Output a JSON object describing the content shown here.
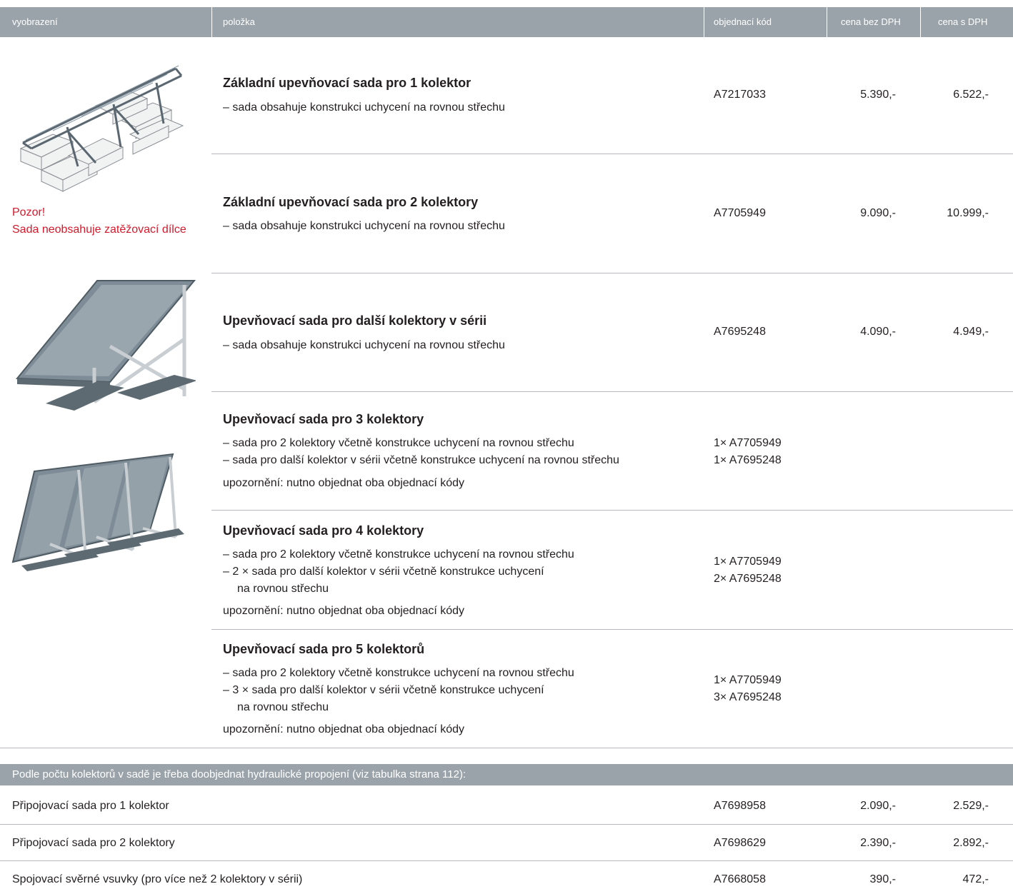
{
  "header": {
    "col_image": "vyobrazení",
    "col_item": "položka",
    "col_code": "objednací kód",
    "col_price_net": "cena bez DPH",
    "col_price_gross": "cena s DPH"
  },
  "warning": {
    "line1": "Pozor!",
    "line2": "Sada neobsahuje zatěžovací dílce"
  },
  "products": [
    {
      "title": "Základní upevňovací sada pro 1 kolektor",
      "lines": [
        "– sada obsahuje konstrukci uchycení na rovnou střechu"
      ],
      "code": "A7217033",
      "price_net": "5.390,-",
      "price_gross": "6.522,-"
    },
    {
      "title": "Základní upevňovací sada pro 2 kolektory",
      "lines": [
        "– sada obsahuje konstrukci uchycení na rovnou střechu"
      ],
      "code": "A7705949",
      "price_net": "9.090,-",
      "price_gross": "10.999,-"
    },
    {
      "title": "Upevňovací sada pro další kolektory v sérii",
      "lines": [
        "– sada obsahuje konstrukci uchycení na rovnou střechu"
      ],
      "code": "A7695248",
      "price_net": "4.090,-",
      "price_gross": "4.949,-"
    },
    {
      "title": "Upevňovací sada pro 3 kolektory",
      "lines": [
        "– sada pro 2 kolektory včetně konstrukce uchycení na rovnou střechu",
        "– sada pro další kolektor v sérii včetně konstrukce uchycení na rovnou střechu"
      ],
      "note": "upozornění: nutno objednat oba objednací kódy",
      "codes": [
        "1× A7705949",
        "1× A7695248"
      ]
    },
    {
      "title": "Upevňovací sada pro 4 kolektory",
      "lines": [
        "– sada pro 2 kolektory včetně konstrukce uchycení na rovnou střechu",
        "– 2 × sada pro další kolektor v sérii včetně konstrukce uchycení",
        "na rovnou střechu"
      ],
      "note": "upozornění: nutno objednat oba objednací kódy",
      "codes": [
        "1× A7705949",
        "2× A7695248"
      ]
    },
    {
      "title": "Upevňovací sada pro 5 kolektorů",
      "lines": [
        "– sada pro 2 kolektory včetně konstrukce uchycení na rovnou střechu",
        "– 3 × sada pro další kolektor v sérii včetně konstrukce uchycení",
        "na rovnou střechu"
      ],
      "note": "upozornění: nutno objednat oba objednací kódy",
      "codes": [
        "1× A7705949",
        "3× A7695248"
      ]
    }
  ],
  "hydraulic": {
    "heading": "Podle počtu kolektorů v sadě je třeba doobjednat hydraulické propojení (viz tabulka strana 112):",
    "rows": [
      {
        "name": "Připojovací sada pro 1 kolektor",
        "code": "A7698958",
        "price_net": "2.090,-",
        "price_gross": "2.529,-"
      },
      {
        "name": "Připojovací sada pro 2 kolektory",
        "code": "A7698629",
        "price_net": "2.390,-",
        "price_gross": "2.892,-"
      },
      {
        "name": "Spojovací svěrné vsuvky (pro více než 2 kolektory v sérii)",
        "code": "A7668058",
        "price_net": "390,-",
        "price_gross": "472,-"
      }
    ]
  }
}
